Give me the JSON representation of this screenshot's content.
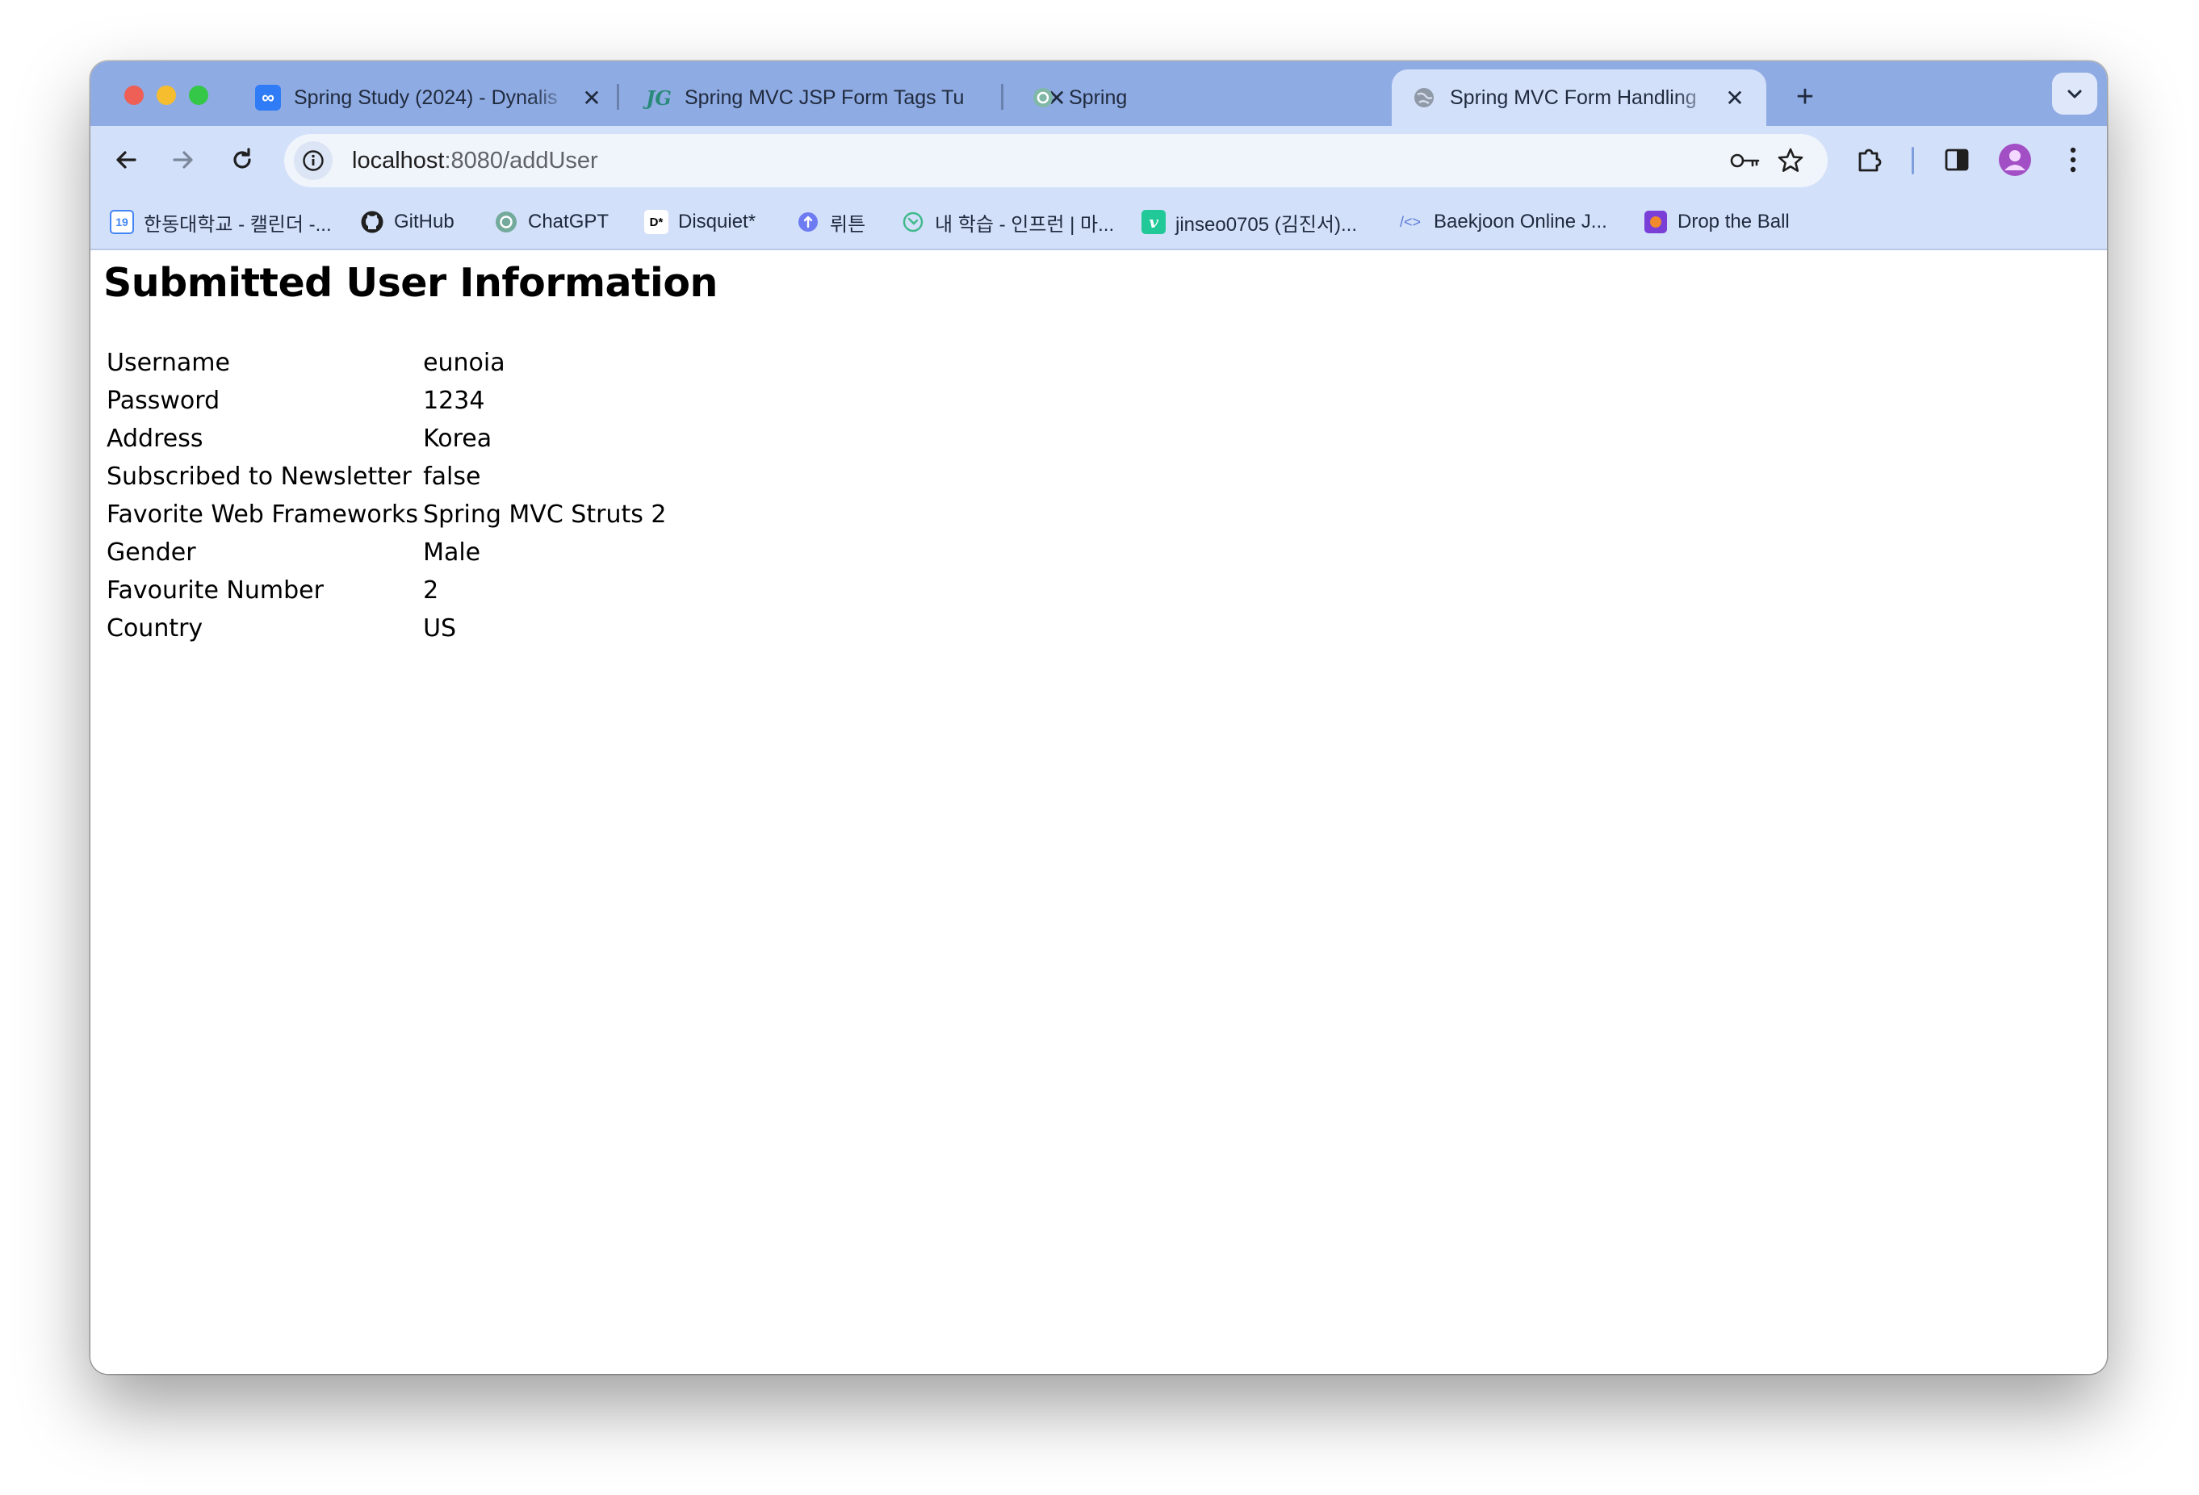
{
  "browser": {
    "tabs": [
      {
        "title": "Spring Study (2024) - Dynalis",
        "active": false
      },
      {
        "title": "Spring MVC JSP Form Tags Tu",
        "active": false
      },
      {
        "title": "Spring",
        "active": false
      },
      {
        "title": "Spring MVC Form Handling",
        "active": true
      }
    ],
    "new_tab_label": "+",
    "url": {
      "host": "localhost",
      "path": ":8080/addUser"
    },
    "bookmarks": [
      {
        "label": "한동대학교 - 캘린더 -...",
        "icon": "calendar-icon",
        "icon_text": "19"
      },
      {
        "label": "GitHub",
        "icon": "github-icon"
      },
      {
        "label": "ChatGPT",
        "icon": "chatgpt-icon"
      },
      {
        "label": "Disquiet*",
        "icon": "disquiet-icon",
        "icon_text": "D*"
      },
      {
        "label": "뤼튼",
        "icon": "wrtn-icon"
      },
      {
        "label": "내 학습 - 인프런 | 마...",
        "icon": "inflearn-icon"
      },
      {
        "label": "jinseo0705 (김진서)...",
        "icon": "velog-icon",
        "icon_text": "v"
      },
      {
        "label": "Baekjoon Online J...",
        "icon": "baekjoon-icon",
        "icon_text": "/<>"
      },
      {
        "label": "Drop the Ball",
        "icon": "drop-the-ball-icon"
      }
    ]
  },
  "page": {
    "title": "Submitted User Information",
    "rows": [
      {
        "label": "Username",
        "value": "eunoia"
      },
      {
        "label": "Password",
        "value": "1234"
      },
      {
        "label": "Address",
        "value": "Korea"
      },
      {
        "label": "Subscribed to Newsletter",
        "value": "false"
      },
      {
        "label": "Favorite Web Frameworks",
        "value": "Spring MVC Struts 2"
      },
      {
        "label": "Gender",
        "value": "Male"
      },
      {
        "label": "Favourite Number",
        "value": "2"
      },
      {
        "label": "Country",
        "value": "US"
      }
    ]
  },
  "colors": {
    "tab_strip": "#8fabe3",
    "toolbar": "#d3e0fa",
    "omnibox": "#f0f4fb",
    "profile": "#a24fc6"
  }
}
